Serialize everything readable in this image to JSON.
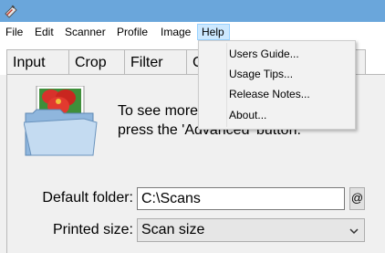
{
  "menubar": {
    "items": [
      "File",
      "Edit",
      "Scanner",
      "Profile",
      "Image",
      "Help"
    ],
    "active": "Help"
  },
  "tabs": [
    "Input",
    "Crop",
    "Filter",
    "C"
  ],
  "help_menu": {
    "items": [
      "Users Guide...",
      "Usage Tips...",
      "Release Notes...",
      "About..."
    ]
  },
  "info": {
    "line1": "To see more",
    "line2": "press the 'Advanced' button."
  },
  "form": {
    "default_folder_label": "Default folder:",
    "default_folder_value": "C:\\Scans",
    "at_button": "@",
    "printed_size_label": "Printed size:",
    "printed_size_value": "Scan size"
  },
  "colors": {
    "titlebar": "#6aa6db",
    "menu_highlight": "#cce8ff",
    "folder_body": "#b8d3ee"
  },
  "icons": {
    "app": "scanner-app-icon",
    "folder": "folder-with-photo-icon",
    "dropdown": "chevron-down-icon"
  }
}
